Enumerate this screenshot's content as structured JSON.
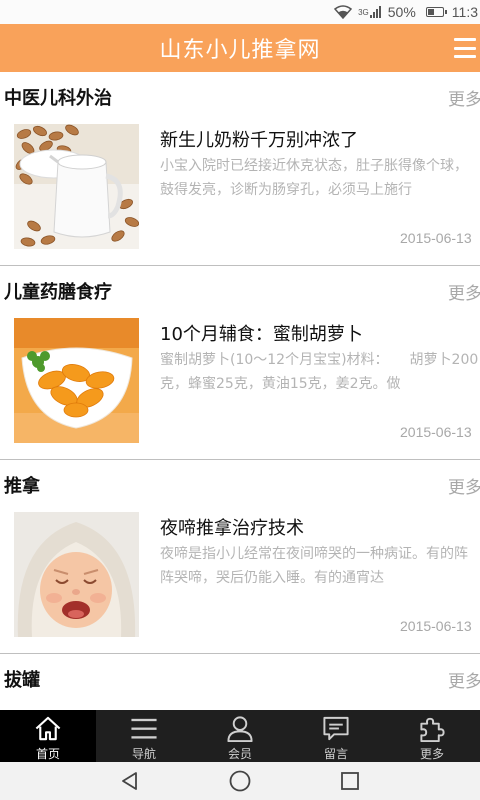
{
  "status_bar": {
    "network": "3G",
    "battery": "50%",
    "battery_level": 0.5,
    "time": "11:3"
  },
  "header": {
    "title": "山东小儿推拿网",
    "menu_icon": "hamburger-menu-icon"
  },
  "sections": [
    {
      "title": "中医儿科外治",
      "more": "更多",
      "article": {
        "title": "新生儿奶粉千万别冲浓了",
        "summary": "小宝入院时已经接近休克状态，肚子胀得像个球，鼓得发亮，诊断为肠穿孔，必须马上施行",
        "date": "2015-06-13",
        "image": "milk-and-almonds"
      }
    },
    {
      "title": "儿童药膳食疗",
      "more": "更多",
      "article": {
        "title": "10个月辅食：蜜制胡萝卜",
        "summary": "蜜制胡萝卜(10～12个月宝宝)材料：　　胡萝卜200克，蜂蜜25克，黄油15克，姜2克。做",
        "date": "2015-06-13",
        "image": "honey-carrot-dish"
      }
    },
    {
      "title": "推拿",
      "more": "更多",
      "article": {
        "title": "夜啼推拿治疗技术",
        "summary": "夜啼是指小儿经常在夜间啼哭的一种病证。有的阵阵哭啼，哭后仍能入睡。有的通宵达",
        "date": "2015-06-13",
        "image": "crying-baby"
      }
    },
    {
      "title": "拔罐",
      "more": "更多"
    }
  ],
  "tabs": [
    {
      "label": "首页",
      "icon": "home-icon",
      "active": true
    },
    {
      "label": "导航",
      "icon": "list-icon",
      "active": false
    },
    {
      "label": "会员",
      "icon": "user-icon",
      "active": false
    },
    {
      "label": "留言",
      "icon": "message-icon",
      "active": false
    },
    {
      "label": "更多",
      "icon": "puzzle-icon",
      "active": false
    }
  ],
  "system_nav": {
    "back": "back-icon",
    "home": "home-circle-icon",
    "recents": "recents-icon"
  },
  "colors": {
    "header_bg": "#f9a25a",
    "tabbar_bg": "#1f1f1f",
    "tab_active_bg": "#000000",
    "summary_text": "#b4b4b4",
    "more_text": "#a8a8a8"
  }
}
